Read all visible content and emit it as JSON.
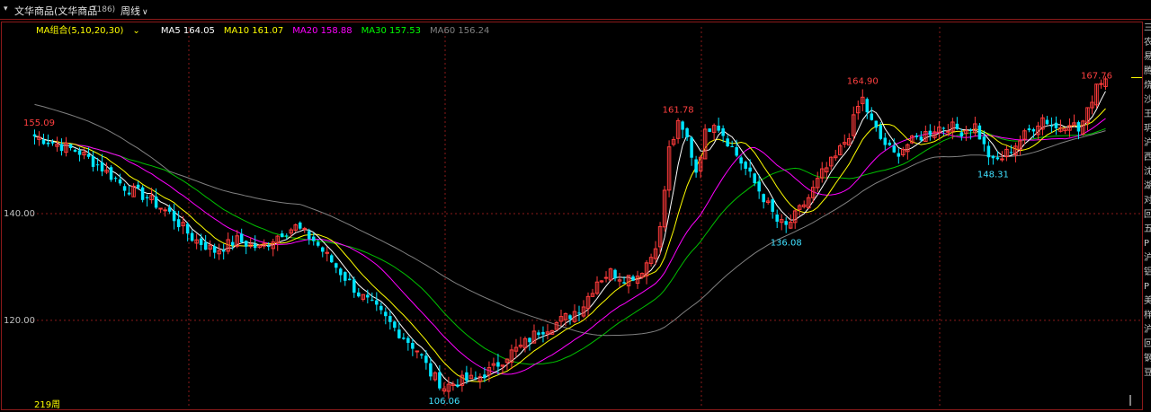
{
  "window": {
    "dropdown_glyph": "▾",
    "title": "文华商品(文华商品",
    "code": "T186)",
    "period_label": "周线",
    "period_chevron": "∨"
  },
  "ma_legend": {
    "combo_label": "MA组合(5,10,20,30)",
    "combo_chevron": "⌄",
    "items": [
      {
        "label": "MA5 164.05",
        "color": "#ffffff"
      },
      {
        "label": "MA10 161.07",
        "color": "#ffff00"
      },
      {
        "label": "MA20 158.88",
        "color": "#ff00ff"
      },
      {
        "label": "MA30 157.53",
        "color": "#00ff00"
      },
      {
        "label": "MA60 156.24",
        "color": "#808080"
      }
    ],
    "combo_color": "#ffff00"
  },
  "colors": {
    "up": "#ff3b3b",
    "down": "#00e5ff",
    "grid": "#8b1a1a",
    "axis_text": "#c0c0c0",
    "high_label": "#ff4040",
    "low_label": "#40e0ff",
    "ma5": "#ffffff",
    "ma10": "#ffff00",
    "ma20": "#ff00ff",
    "ma30": "#00c000",
    "ma60": "#808080"
  },
  "footer": {
    "bar_count_label": "219周"
  },
  "right_strip_chars": [
    "三",
    "农",
    "易",
    "腾",
    "烧",
    "沙",
    "王",
    "玥",
    "沪",
    "西",
    "沈",
    "湖",
    "对",
    "回",
    "五",
    "P",
    "沪",
    "铝",
    "P",
    "美",
    "样",
    "沪",
    "回",
    "钢",
    "豆"
  ],
  "chart_data": {
    "type": "candlestick",
    "title": "文华商品(文华商品 T186) 周线",
    "ylabel": "",
    "ylim": [
      104,
      174
    ],
    "y_ticks": [
      120.0,
      140.0
    ],
    "y_tick_labels": [
      "120.00",
      "140.00"
    ],
    "grid": "dotted",
    "annotations": [
      {
        "text": "155.09",
        "kind": "high",
        "x": 1
      },
      {
        "text": "106.06",
        "kind": "low",
        "x": 91
      },
      {
        "text": "161.78",
        "kind": "high",
        "x": 143
      },
      {
        "text": "136.08",
        "kind": "low",
        "x": 167
      },
      {
        "text": "164.90",
        "kind": "high",
        "x": 184
      },
      {
        "text": "148.31",
        "kind": "low",
        "x": 213
      },
      {
        "text": "167.76",
        "kind": "high",
        "x": 236
      }
    ],
    "anchors": [
      [
        0,
        154.5
      ],
      [
        5,
        153.0
      ],
      [
        10,
        151.5
      ],
      [
        15,
        148.5
      ],
      [
        20,
        145.0
      ],
      [
        25,
        143.0
      ],
      [
        30,
        140.0
      ],
      [
        35,
        135.5
      ],
      [
        40,
        133.0
      ],
      [
        45,
        135.0
      ],
      [
        50,
        133.5
      ],
      [
        55,
        136.5
      ],
      [
        58,
        137.5
      ],
      [
        62,
        135.0
      ],
      [
        67,
        130.0
      ],
      [
        72,
        125.0
      ],
      [
        76,
        122.0
      ],
      [
        80,
        118.5
      ],
      [
        85,
        114.5
      ],
      [
        88,
        110.0
      ],
      [
        91,
        107.5
      ],
      [
        94,
        108.5
      ],
      [
        98,
        109.0
      ],
      [
        102,
        111.0
      ],
      [
        105,
        113.5
      ],
      [
        108,
        115.0
      ],
      [
        112,
        118.0
      ],
      [
        116,
        119.5
      ],
      [
        119,
        121.0
      ],
      [
        122,
        123.0
      ],
      [
        125,
        127.5
      ],
      [
        128,
        129.0
      ],
      [
        131,
        128.0
      ],
      [
        134,
        128.5
      ],
      [
        137,
        132.0
      ],
      [
        139,
        137.0
      ],
      [
        141,
        152.0
      ],
      [
        143,
        156.5
      ],
      [
        145,
        154.0
      ],
      [
        147,
        148.0
      ],
      [
        149,
        155.0
      ],
      [
        151,
        157.5
      ],
      [
        153,
        155.0
      ],
      [
        156,
        151.0
      ],
      [
        159,
        147.0
      ],
      [
        162,
        143.0
      ],
      [
        165,
        138.5
      ],
      [
        167,
        137.5
      ],
      [
        169,
        139.5
      ],
      [
        172,
        143.0
      ],
      [
        175,
        147.5
      ],
      [
        178,
        150.5
      ],
      [
        181,
        155.0
      ],
      [
        183,
        160.0
      ],
      [
        184,
        161.5
      ],
      [
        186,
        157.0
      ],
      [
        188,
        154.0
      ],
      [
        191,
        151.0
      ],
      [
        194,
        153.0
      ],
      [
        197,
        154.5
      ],
      [
        200,
        156.0
      ],
      [
        203,
        156.5
      ],
      [
        206,
        155.5
      ],
      [
        209,
        156.5
      ],
      [
        211,
        152.5
      ],
      [
        213,
        149.5
      ],
      [
        215,
        150.5
      ],
      [
        218,
        153.0
      ],
      [
        221,
        155.5
      ],
      [
        224,
        158.0
      ],
      [
        227,
        156.0
      ],
      [
        230,
        157.5
      ],
      [
        232,
        155.5
      ],
      [
        234,
        159.0
      ],
      [
        236,
        164.5
      ],
      [
        238,
        165.5
      ]
    ],
    "bar_count": 239,
    "seed": 7
  }
}
